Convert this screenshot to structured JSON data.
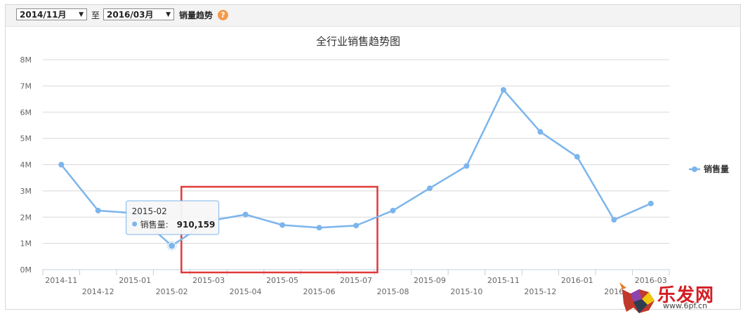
{
  "toolbar": {
    "start_value": "2014/11月",
    "separator": "至",
    "end_value": "2016/03月",
    "trend_label": "销量趋势",
    "help_icon": "question-icon",
    "help_glyph": "?",
    "dropdown_glyph": "▼"
  },
  "chart_data": {
    "type": "line",
    "title": "全行业销售趋势图",
    "xlabel": "",
    "ylabel": "",
    "ylim": [
      0,
      8000000
    ],
    "yticks": [
      "0M",
      "1M",
      "2M",
      "3M",
      "4M",
      "5M",
      "6M",
      "7M",
      "8M"
    ],
    "categories": [
      "2014-11",
      "2014-12",
      "2015-01",
      "2015-02",
      "2015-03",
      "2015-04",
      "2015-05",
      "2015-06",
      "2015-07",
      "2015-08",
      "2015-09",
      "2015-10",
      "2015-11",
      "2015-12",
      "2016-01",
      "2016-02",
      "2016-03"
    ],
    "tick_labels": [
      "2014-11",
      "2014-12",
      "2015-01",
      "2015-02",
      "2015-03",
      "2015-04",
      "2015-05",
      "2015-06",
      "2015-07",
      "2015-08",
      "2015-09",
      "2015-10",
      "2015-11",
      "2015-12",
      "2016-01",
      "2016",
      "2016-03"
    ],
    "series": [
      {
        "name": "销售量",
        "color": "#7cb5ec",
        "values": [
          4000000,
          2250000,
          2150000,
          910159,
          1850000,
          2100000,
          1700000,
          1600000,
          1680000,
          2250000,
          3100000,
          3950000,
          6850000,
          5250000,
          4300000,
          1900000,
          2520000
        ]
      }
    ],
    "legend": {
      "position": "right"
    },
    "grid": true,
    "tooltip": {
      "category": "2015-02",
      "series_label": "销售量:",
      "value_text": "910,159"
    },
    "highlight_box": {
      "from": "2015-03",
      "to": "2015-07",
      "color": "#e03a3a"
    }
  },
  "watermark": {
    "text": "乐发网",
    "url": "www.6pf.cn",
    "logo": "bull-logo-icon"
  }
}
